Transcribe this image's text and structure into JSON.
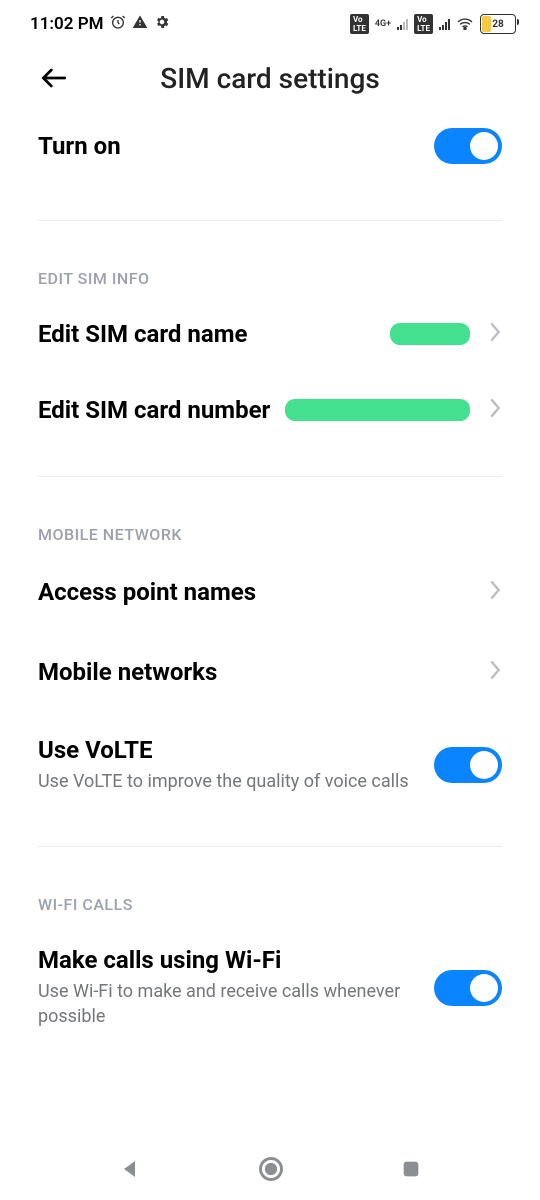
{
  "status": {
    "time": "11:02 PM",
    "net_label": "4G+",
    "battery_pct": "28"
  },
  "header": {
    "title": "SIM card settings"
  },
  "turn_on": {
    "label": "Turn on"
  },
  "sections": {
    "sim_info": "EDIT SIM INFO",
    "mobile_net": "MOBILE NETWORK",
    "wifi_calls": "WI-FI CALLS"
  },
  "rows": {
    "edit_name": "Edit SIM card name",
    "edit_number": "Edit SIM card number",
    "apn": "Access point names",
    "mobile_networks": "Mobile networks",
    "volte": {
      "label": "Use VoLTE",
      "sub": "Use VoLTE to improve the quality of voice calls"
    },
    "wifi_call": {
      "label": "Make calls using Wi-Fi",
      "sub": "Use Wi-Fi to make and receive calls whenever possible"
    }
  }
}
